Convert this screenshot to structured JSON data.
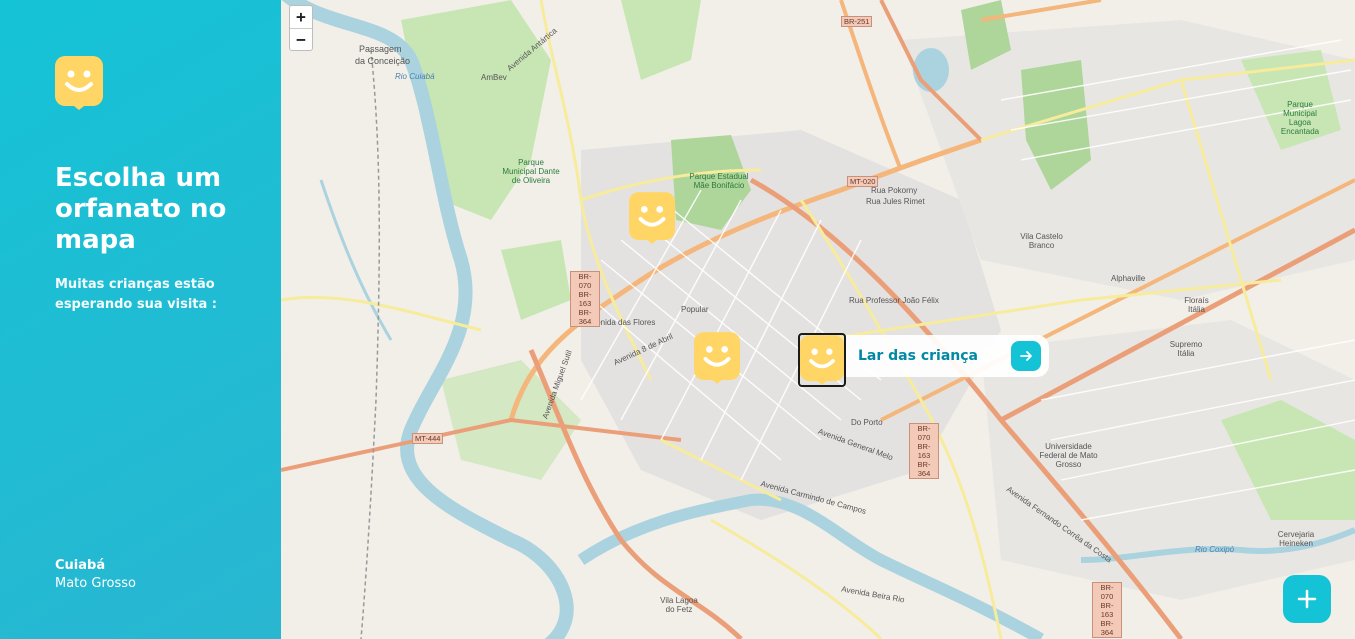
{
  "sidebar": {
    "title": "Escolha um orfanato no mapa",
    "subtitle": "Muitas crianças estão esperando sua visita :",
    "city": "Cuiabá",
    "state": "Mato Grosso"
  },
  "map": {
    "zoom_in": "+",
    "zoom_out": "−",
    "popup_name": "Lar das criança",
    "labels": {
      "passagem": "Passagem",
      "da_conceicao": "da Conceição",
      "rio_cuiaba": "Rio Cuiabá",
      "ambev": "AmBev",
      "parque_dante": "Parque Municipal Dante de Oliveira",
      "parque_mae": "Parque Estadual Mãe Bonifácio",
      "popular": "Popular",
      "vila_castelo": "Vila Castelo Branco",
      "alphaville": "Alphaville",
      "floraís": "Floraís Itália",
      "supremo": "Supremo Itália",
      "universidade": "Universidade Federal de Mato Grosso",
      "do_porto": "Do Porto",
      "av_flores": "Avenida das Flores",
      "av_8abril": "Avenida 8 de Abril",
      "av_general": "Avenida General Melo",
      "av_carmindo": "Avenida Carmindo de Campos",
      "av_fernando": "Avenida Fernando Corrêa da Costa",
      "av_miguel": "Avenida Miguel Sutil",
      "av_beira": "Avenida Beira Rio",
      "vila_lagoa": "Vila Lagoa do Fetz",
      "mt444": "MT-444",
      "mt020": "MT-020",
      "br251": "BR-251",
      "br_stack_1": "BR-070 BR-163 BR-364",
      "br_stack_2": "BR-070 BR-163 BR-364",
      "br_stack_3": "BR-070 BR-163 BR-364",
      "rio_coxipo": "Rio Coxipó",
      "parque_lagoa": "Parque Municipal Lagoa Encantada",
      "cervejaria": "Cervejaria Heineken",
      "rua_pokora": "Rua Pokorny",
      "rua_jules": "Rua Jules Rimet",
      "rua_prof": "Rua Professor João Félix",
      "av_antartica": "Avenida Antártica"
    }
  },
  "colors": {
    "accent": "#15c3d6",
    "accent_dark": "#29b6d1",
    "marker": "#ffd666",
    "popup_text": "#0089a5"
  },
  "icons": {
    "logo": "happy-face-map-pin",
    "marker": "happy-face-map-pin",
    "go": "arrow-right-icon",
    "add": "plus-icon"
  }
}
